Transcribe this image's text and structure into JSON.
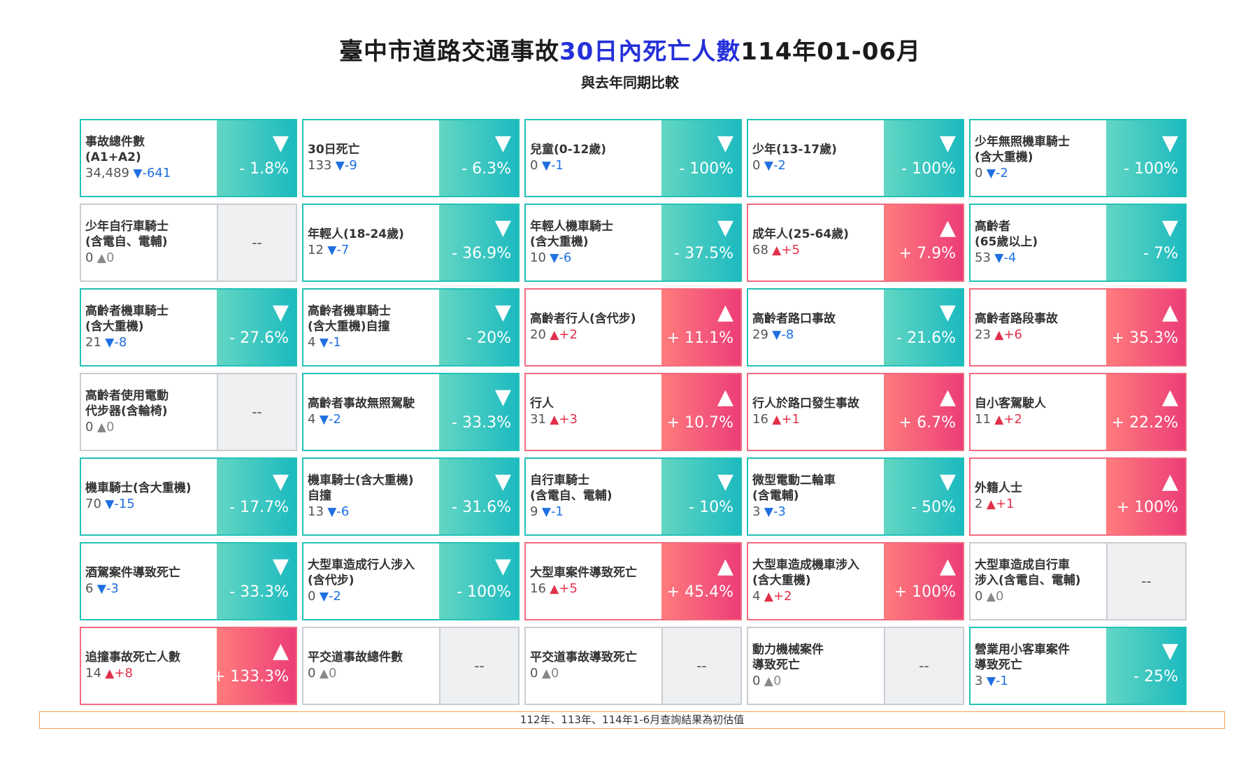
{
  "header": {
    "title_part1": "臺中市道路交通事故",
    "title_part2": "30日內死亡人數",
    "title_part3": "114年01-06月",
    "subtitle": "與去年同期比較"
  },
  "footnote": "112年、113年、114年1-6月查詢結果為初估值",
  "colors": {
    "down": "#1cbac0",
    "up": "#ec3d78",
    "none": "#eef0f2",
    "title_accent": "#2430d9"
  },
  "chart_data": {
    "type": "table",
    "title": "臺中市道路交通事故30日內死亡人數114年01-06月",
    "subtitle": "與去年同期比較",
    "cards": [
      {
        "label": "事故總件數\n(A1+A2)",
        "value": "34,489",
        "direction": "down",
        "change": "-641",
        "percent": "- 1.8%"
      },
      {
        "label": "30日死亡",
        "value": "133",
        "direction": "down",
        "change": "-9",
        "percent": "- 6.3%"
      },
      {
        "label": "兒童(0-12歲)",
        "value": "0",
        "direction": "down",
        "change": "-1",
        "percent": "- 100%"
      },
      {
        "label": "少年(13-17歲)",
        "value": "0",
        "direction": "down",
        "change": "-2",
        "percent": "- 100%"
      },
      {
        "label": "少年無照機車騎士\n(含大重機)",
        "value": "0",
        "direction": "down",
        "change": "-2",
        "percent": "- 100%"
      },
      {
        "label": "少年自行車騎士\n(含電自、電輔)",
        "value": "0",
        "direction": "none",
        "change": "0",
        "percent": "--"
      },
      {
        "label": "年輕人(18-24歲)",
        "value": "12",
        "direction": "down",
        "change": "-7",
        "percent": "- 36.9%"
      },
      {
        "label": "年輕人機車騎士\n(含大重機)",
        "value": "10",
        "direction": "down",
        "change": "-6",
        "percent": "- 37.5%"
      },
      {
        "label": "成年人(25-64歲)",
        "value": "68",
        "direction": "up",
        "change": "+5",
        "percent": "+ 7.9%"
      },
      {
        "label": "高齡者\n(65歲以上)",
        "value": "53",
        "direction": "down",
        "change": "-4",
        "percent": "- 7%"
      },
      {
        "label": "高齡者機車騎士\n(含大重機)",
        "value": "21",
        "direction": "down",
        "change": "-8",
        "percent": "- 27.6%"
      },
      {
        "label": "高齡者機車騎士\n(含大重機)自撞",
        "value": "4",
        "direction": "down",
        "change": "-1",
        "percent": "- 20%"
      },
      {
        "label": "高齡者行人(含代步)",
        "value": "20",
        "direction": "up",
        "change": "+2",
        "percent": "+ 11.1%"
      },
      {
        "label": "高齡者路口事故",
        "value": "29",
        "direction": "down",
        "change": "-8",
        "percent": "- 21.6%"
      },
      {
        "label": "高齡者路段事故",
        "value": "23",
        "direction": "up",
        "change": "+6",
        "percent": "+ 35.3%"
      },
      {
        "label": "高齡者使用電動\n代步器(含輪椅)",
        "value": "0",
        "direction": "none",
        "change": "0",
        "percent": "--"
      },
      {
        "label": "高齡者事故無照駕駛",
        "value": "4",
        "direction": "down",
        "change": "-2",
        "percent": "- 33.3%"
      },
      {
        "label": "行人",
        "value": "31",
        "direction": "up",
        "change": "+3",
        "percent": "+ 10.7%"
      },
      {
        "label": "行人於路口發生事故",
        "value": "16",
        "direction": "up",
        "change": "+1",
        "percent": "+ 6.7%"
      },
      {
        "label": "自小客駕駛人",
        "value": "11",
        "direction": "up",
        "change": "+2",
        "percent": "+ 22.2%"
      },
      {
        "label": "機車騎士(含大重機)",
        "value": "70",
        "direction": "down",
        "change": "-15",
        "percent": "- 17.7%"
      },
      {
        "label": "機車騎士(含大重機)\n自撞",
        "value": "13",
        "direction": "down",
        "change": "-6",
        "percent": "- 31.6%"
      },
      {
        "label": "自行車騎士\n(含電自、電輔)",
        "value": "9",
        "direction": "down",
        "change": "-1",
        "percent": "- 10%"
      },
      {
        "label": "微型電動二輪車\n(含電輔)",
        "value": "3",
        "direction": "down",
        "change": "-3",
        "percent": "- 50%"
      },
      {
        "label": "外籍人士",
        "value": "2",
        "direction": "up",
        "change": "+1",
        "percent": "+ 100%"
      },
      {
        "label": "酒駕案件導致死亡",
        "value": "6",
        "direction": "down",
        "change": "-3",
        "percent": "- 33.3%"
      },
      {
        "label": "大型車造成行人涉入\n(含代步)",
        "value": "0",
        "direction": "down",
        "change": "-2",
        "percent": "- 100%"
      },
      {
        "label": "大型車案件導致死亡",
        "value": "16",
        "direction": "up",
        "change": "+5",
        "percent": "+ 45.4%"
      },
      {
        "label": "大型車造成機車涉入\n(含大重機)",
        "value": "4",
        "direction": "up",
        "change": "+2",
        "percent": "+ 100%"
      },
      {
        "label": "大型車造成自行車\n涉入(含電自、電輔)",
        "value": "0",
        "direction": "none",
        "change": "0",
        "percent": "--"
      },
      {
        "label": "追撞事故死亡人數",
        "value": "14",
        "direction": "up",
        "change": "+8",
        "percent": "+ 133.3%"
      },
      {
        "label": "平交道事故總件數",
        "value": "0",
        "direction": "none",
        "change": "0",
        "percent": "--"
      },
      {
        "label": "平交道事故導致死亡",
        "value": "0",
        "direction": "none",
        "change": "0",
        "percent": "--"
      },
      {
        "label": "動力機械案件\n導致死亡",
        "value": "0",
        "direction": "none",
        "change": "0",
        "percent": "--"
      },
      {
        "label": "營業用小客車案件\n導致死亡",
        "value": "3",
        "direction": "down",
        "change": "-1",
        "percent": "- 25%"
      }
    ]
  }
}
